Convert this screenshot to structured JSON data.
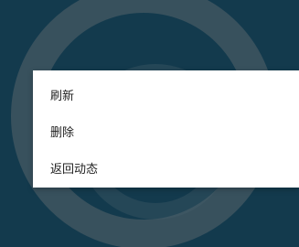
{
  "context_menu": {
    "items": [
      {
        "label": "刷新"
      },
      {
        "label": "删除"
      },
      {
        "label": "返回动态"
      }
    ]
  },
  "colors": {
    "background": "#1b4a60",
    "menu_bg": "#ffffff",
    "menu_text": "#222222"
  }
}
